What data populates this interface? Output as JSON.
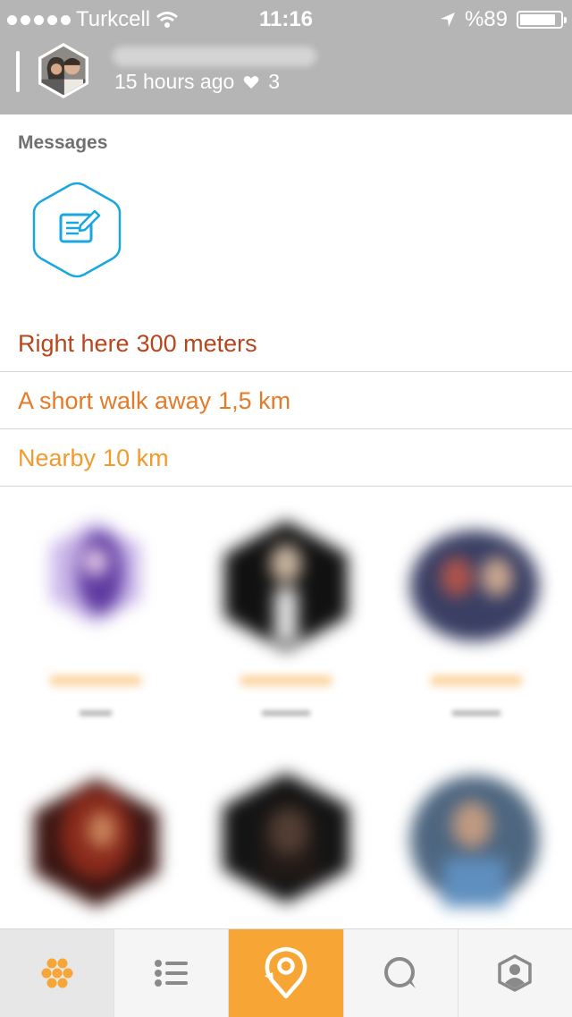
{
  "status_bar": {
    "carrier": "Turkcell",
    "time": "11:16",
    "battery_percent_label": "%89",
    "battery_level": 0.89,
    "icons": [
      "signal-dots-icon",
      "wifi-icon",
      "location-arrow-icon",
      "battery-icon"
    ]
  },
  "header": {
    "time_ago": "15 hours ago",
    "likes": "3",
    "icons": [
      "heart-icon"
    ]
  },
  "messages": {
    "title": "Messages",
    "compose_icon": "compose-icon"
  },
  "distance_rows": [
    {
      "label": "Right here",
      "distance": "300 meters",
      "color": "#b8461c"
    },
    {
      "label": "A short walk away",
      "distance": "1,5 km",
      "color": "#e57a27"
    },
    {
      "label": "Nearby",
      "distance": "10 km",
      "color": "#f29a2e"
    }
  ],
  "tab_bar": {
    "tabs": [
      {
        "icon": "hex-cluster-icon",
        "selected": true
      },
      {
        "icon": "list-icon",
        "selected": false
      },
      {
        "icon": "location-refresh-icon",
        "selected": false,
        "highlight": true
      },
      {
        "icon": "chat-bubble-icon",
        "selected": false
      },
      {
        "icon": "profile-icon",
        "selected": false
      }
    ]
  },
  "colors": {
    "header_bg": "#b5b5b5",
    "accent": "#f7a635",
    "compose_blue": "#1aa7e0"
  }
}
